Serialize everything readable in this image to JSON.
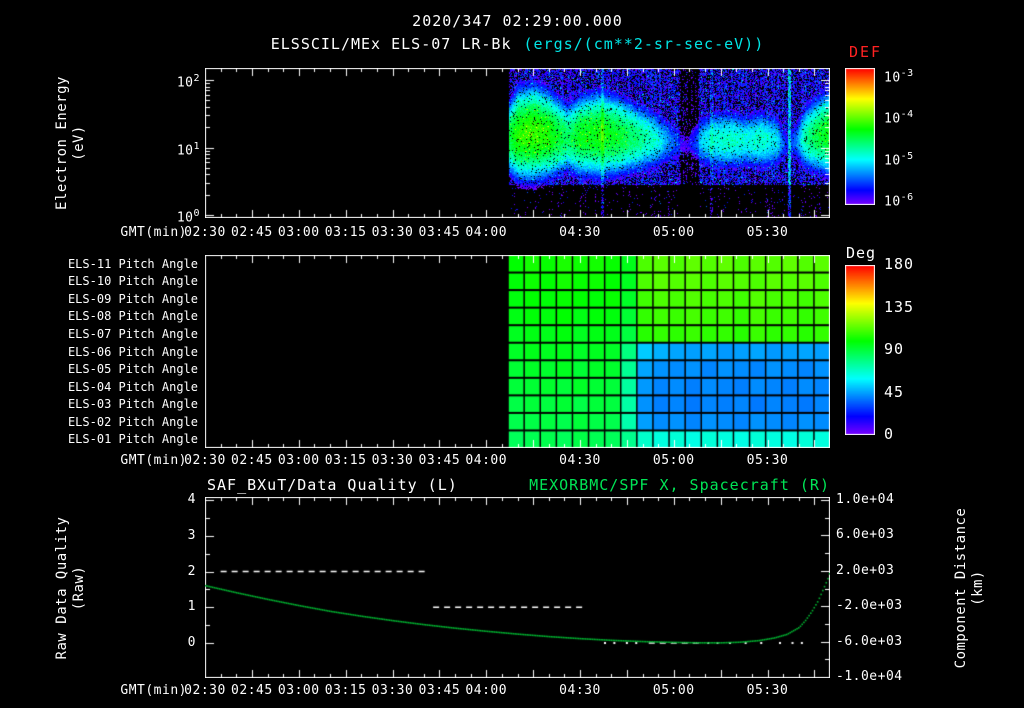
{
  "colors": {
    "background": "#000000",
    "text": "#ffffff",
    "accent_units": "#00e5e5",
    "def_label": "#ff2222",
    "right_title": "#00e556",
    "curve": "#00b431",
    "frame": "#ffffff",
    "quality": "#ffffff"
  },
  "header": {
    "timestamp": "2020/347 02:29:00.000",
    "title": "ELSSCIL/MEx ELS-07 LR-Bk",
    "units": "(ergs/(cm**2-sr-sec-eV))",
    "def_label": "DEF"
  },
  "time_axis": {
    "label": "GMT(min)",
    "t_start": 150,
    "t_end": 350,
    "labeled_ticks": [
      {
        "t": 150,
        "label": "02:30"
      },
      {
        "t": 165,
        "label": "02:45"
      },
      {
        "t": 180,
        "label": "03:00"
      },
      {
        "t": 195,
        "label": "03:15"
      },
      {
        "t": 210,
        "label": "03:30"
      },
      {
        "t": 225,
        "label": "03:45"
      },
      {
        "t": 240,
        "label": "04:00"
      },
      {
        "t": 270,
        "label": "04:30"
      },
      {
        "t": 300,
        "label": "05:00"
      },
      {
        "t": 330,
        "label": "05:30"
      }
    ]
  },
  "panel1": {
    "ylabel": [
      "Electron Energy",
      "(eV)"
    ],
    "y_ticks": [
      {
        "base": "10",
        "exp": "2",
        "log": 2
      },
      {
        "base": "10",
        "exp": "1",
        "log": 1
      },
      {
        "base": "10",
        "exp": "0",
        "log": 0
      }
    ]
  },
  "colorbar1": {
    "ticks": [
      {
        "base": "10",
        "exp": "-3"
      },
      {
        "base": "10",
        "exp": "-4"
      },
      {
        "base": "10",
        "exp": "-5"
      },
      {
        "base": "10",
        "exp": "-6"
      }
    ]
  },
  "panel2": {
    "rows": [
      "ELS-11 Pitch Angle",
      "ELS-10 Pitch Angle",
      "ELS-09 Pitch Angle",
      "ELS-08 Pitch Angle",
      "ELS-07 Pitch Angle",
      "ELS-06 Pitch Angle",
      "ELS-05 Pitch Angle",
      "ELS-04 Pitch Angle",
      "ELS-03 Pitch Angle",
      "ELS-02 Pitch Angle",
      "ELS-01 Pitch Angle"
    ]
  },
  "colorbar2": {
    "label": "Deg",
    "ticks": [
      {
        "v": 180,
        "label": "180"
      },
      {
        "v": 135,
        "label": "135"
      },
      {
        "v": 90,
        "label": "90"
      },
      {
        "v": 45,
        "label": "45"
      },
      {
        "v": 0,
        "label": "0"
      }
    ]
  },
  "panel3": {
    "title_left": "SAF_BXuT/Data Quality (L)",
    "title_right": "MEXORBMC/SPF X, Spacecraft (R)",
    "ylabel_left": [
      "Raw Data Quality",
      "(Raw)"
    ],
    "ylabel_right": [
      "Component Distance",
      "(km)"
    ],
    "yleft_ticks": [
      {
        "v": 4,
        "label": "4"
      },
      {
        "v": 3,
        "label": "3"
      },
      {
        "v": 2,
        "label": "2"
      },
      {
        "v": 1,
        "label": "1"
      },
      {
        "v": 0,
        "label": "0"
      }
    ],
    "yright_ticks": [
      {
        "v": 10000,
        "label": "1.0e+04"
      },
      {
        "v": 6000,
        "label": "6.0e+03"
      },
      {
        "v": 2000,
        "label": "2.0e+03"
      },
      {
        "v": -2000,
        "label": "-2.0e+03"
      },
      {
        "v": -6000,
        "label": "-6.0e+03"
      },
      {
        "v": -10000,
        "label": "-1.0e+04"
      }
    ]
  },
  "chart_data": [
    {
      "type": "heatmap",
      "name": "electron_energy_spectrogram",
      "title": "ELSSCIL/MEx ELS-07 LR-Bk",
      "units": "ergs/(cm**2-sr-sec-eV)",
      "xlabel": "GMT(min)",
      "x_minutes_range": [
        150,
        350
      ],
      "ylabel": "Electron Energy (eV)",
      "y_scale": "log",
      "y_ev_range": [
        1,
        160
      ],
      "colorbar_label": "DEF",
      "color_scale_log_range": [
        -6,
        -3
      ],
      "data_start_minute": 247,
      "background_log10_flux": -5.85,
      "band_profile": [
        [
          247,
          -4.35,
          1.15,
          0.33
        ],
        [
          250,
          -4.1,
          1.2,
          0.42
        ],
        [
          255,
          -4.05,
          1.22,
          0.44
        ],
        [
          260,
          -4.15,
          1.2,
          0.4
        ],
        [
          266,
          -4.45,
          1.15,
          0.33
        ],
        [
          270,
          -4.25,
          1.18,
          0.38
        ],
        [
          276,
          -4.2,
          1.2,
          0.4
        ],
        [
          282,
          -4.3,
          1.18,
          0.38
        ],
        [
          288,
          -4.5,
          1.15,
          0.34
        ],
        [
          294,
          -4.75,
          1.12,
          0.3
        ],
        [
          300,
          -5.3,
          1.08,
          0.24
        ],
        [
          304,
          -5.5,
          1.05,
          0.22
        ],
        [
          308,
          -5.0,
          1.1,
          0.27
        ],
        [
          313,
          -4.75,
          1.12,
          0.3
        ],
        [
          318,
          -4.7,
          1.12,
          0.3
        ],
        [
          323,
          -4.8,
          1.1,
          0.28
        ],
        [
          328,
          -4.7,
          1.12,
          0.3
        ],
        [
          333,
          -4.9,
          1.1,
          0.28
        ],
        [
          336,
          -5.5,
          1.05,
          0.2
        ],
        [
          339,
          -5.2,
          1.1,
          0.24
        ],
        [
          342,
          -4.6,
          1.15,
          0.32
        ],
        [
          346,
          -4.35,
          1.2,
          0.36
        ],
        [
          350,
          -4.2,
          1.22,
          0.4
        ]
      ],
      "streaks": [
        [
          276.5,
          277.5,
          0.5
        ],
        [
          302,
          308,
          -0.45
        ],
        [
          311.5,
          312.5,
          0.3
        ],
        [
          336.5,
          337.5,
          0.7
        ]
      ]
    },
    {
      "type": "heatmap",
      "name": "pitch_angle_per_anode",
      "rows_top_to_bottom": [
        "ELS-11",
        "ELS-10",
        "ELS-09",
        "ELS-08",
        "ELS-07",
        "ELS-06",
        "ELS-05",
        "ELS-04",
        "ELS-03",
        "ELS-02",
        "ELS-01"
      ],
      "unit": "deg",
      "range": [
        0,
        180
      ],
      "colorbar_label": "Deg",
      "data_start_minute": 247,
      "n_time_bins": 20,
      "values_deg": [
        [
          100,
          103,
          101,
          104,
          102,
          103,
          101,
          96,
          112,
          114,
          112,
          115,
          113,
          115,
          112,
          114,
          113,
          115,
          113,
          114
        ],
        [
          99,
          102,
          100,
          103,
          101,
          102,
          100,
          95,
          112,
          114,
          113,
          114,
          112,
          114,
          113,
          112,
          114,
          113,
          114,
          112
        ],
        [
          98,
          100,
          99,
          101,
          100,
          99,
          101,
          94,
          110,
          112,
          111,
          113,
          111,
          112,
          110,
          113,
          111,
          112,
          110,
          112
        ],
        [
          97,
          99,
          98,
          100,
          97,
          99,
          98,
          92,
          108,
          110,
          109,
          111,
          109,
          110,
          108,
          111,
          109,
          110,
          108,
          110
        ],
        [
          95,
          97,
          96,
          98,
          95,
          97,
          96,
          90,
          106,
          108,
          107,
          109,
          107,
          108,
          106,
          109,
          107,
          108,
          106,
          108
        ],
        [
          94,
          96,
          95,
          96,
          94,
          95,
          94,
          80,
          52,
          48,
          46,
          45,
          46,
          44,
          45,
          46,
          44,
          45,
          46,
          45
        ],
        [
          92,
          94,
          93,
          95,
          92,
          94,
          93,
          77,
          46,
          43,
          42,
          43,
          41,
          43,
          42,
          41,
          43,
          42,
          41,
          43
        ],
        [
          91,
          92,
          93,
          91,
          94,
          92,
          91,
          75,
          44,
          41,
          42,
          40,
          42,
          41,
          40,
          42,
          41,
          40,
          42,
          41
        ],
        [
          89,
          91,
          90,
          92,
          89,
          91,
          90,
          74,
          43,
          40,
          41,
          39,
          41,
          40,
          41,
          39,
          41,
          40,
          39,
          41
        ],
        [
          88,
          89,
          90,
          88,
          91,
          89,
          88,
          73,
          45,
          42,
          43,
          41,
          43,
          42,
          41,
          43,
          42,
          41,
          43,
          42
        ],
        [
          86,
          87,
          88,
          86,
          89,
          87,
          86,
          78,
          68,
          65,
          66,
          64,
          66,
          65,
          64,
          66,
          65,
          64,
          66,
          65
        ]
      ]
    },
    {
      "type": "line",
      "name": "quality_and_spacecraft_x",
      "title_left": "SAF_BXuT/Data Quality (L)",
      "title_right": "MEXORBMC/SPF X, Spacecraft (R)",
      "yleft_range": [
        0,
        4
      ],
      "yright_range": [
        -10000,
        10000
      ],
      "series": [
        {
          "name": "SAF_BXuT/Data Quality",
          "axis": "left",
          "units": "Raw",
          "style": "dashed_white",
          "segments": [
            [
              155,
              221,
              2
            ],
            [
              223,
              272,
              1
            ],
            [
              292,
              308,
              0
            ]
          ],
          "dots": [
            [
              278,
              0
            ],
            [
              281,
              0
            ],
            [
              285,
              0
            ],
            [
              288,
              0
            ],
            [
              311,
              0
            ],
            [
              314,
              0
            ],
            [
              318,
              0
            ],
            [
              323,
              0
            ],
            [
              328,
              0
            ],
            [
              334,
              0
            ],
            [
              338,
              0
            ],
            [
              341,
              0
            ]
          ]
        },
        {
          "name": "MEXORBMC/SPF X, Spacecraft",
          "axis": "right",
          "units": "km",
          "style": "dotted_green",
          "points": [
            [
              150,
              400
            ],
            [
              160,
              -400
            ],
            [
              170,
              -1150
            ],
            [
              180,
              -1850
            ],
            [
              190,
              -2500
            ],
            [
              200,
              -3050
            ],
            [
              210,
              -3550
            ],
            [
              220,
              -4000
            ],
            [
              230,
              -4400
            ],
            [
              240,
              -4750
            ],
            [
              250,
              -5070
            ],
            [
              260,
              -5350
            ],
            [
              270,
              -5580
            ],
            [
              280,
              -5770
            ],
            [
              290,
              -5910
            ],
            [
              300,
              -6000
            ],
            [
              308,
              -6050
            ],
            [
              315,
              -6050
            ],
            [
              321,
              -5980
            ],
            [
              327,
              -5800
            ],
            [
              332,
              -5500
            ],
            [
              336,
              -5100
            ],
            [
              340,
              -4300
            ],
            [
              342,
              -3500
            ],
            [
              344,
              -2500
            ],
            [
              346,
              -1300
            ],
            [
              347.5,
              -100
            ],
            [
              349,
              1100
            ],
            [
              350,
              2100
            ]
          ]
        }
      ]
    }
  ]
}
